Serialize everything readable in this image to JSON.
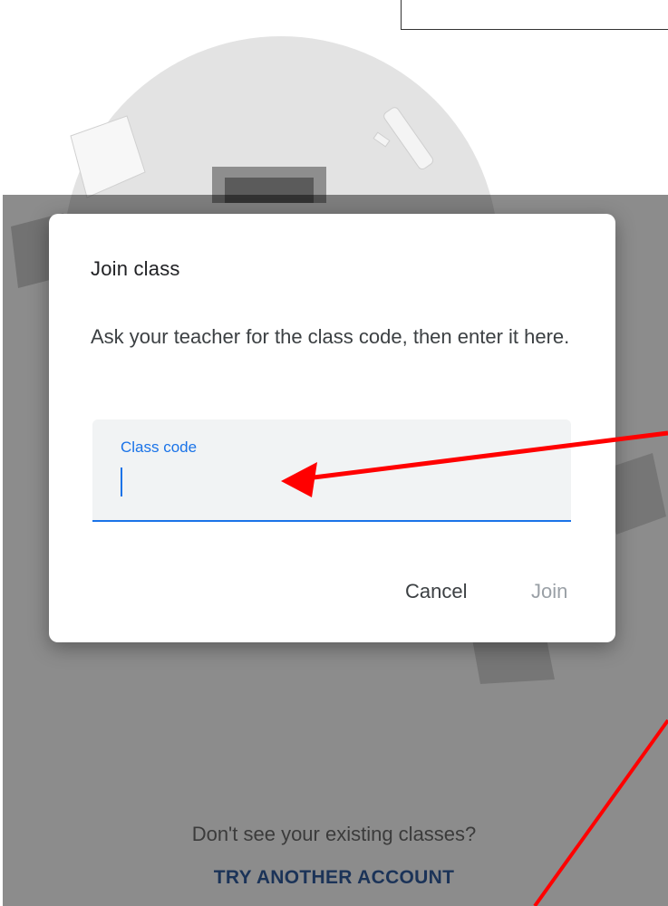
{
  "dialog": {
    "title": "Join class",
    "description": "Ask your teacher for the class code, then enter it here.",
    "field_label": "Class code",
    "field_value": "",
    "cancel_label": "Cancel",
    "join_label": "Join"
  },
  "footer": {
    "question": "Don't see your existing classes?",
    "link_label": "TRY ANOTHER ACCOUNT"
  },
  "colors": {
    "accent": "#1a73e8",
    "annotation_arrow": "#ff0000",
    "disabled_text": "#9aa0a6",
    "link": "#1b3358"
  },
  "icons": [
    "classroom-illustration",
    "annotation-arrow"
  ]
}
